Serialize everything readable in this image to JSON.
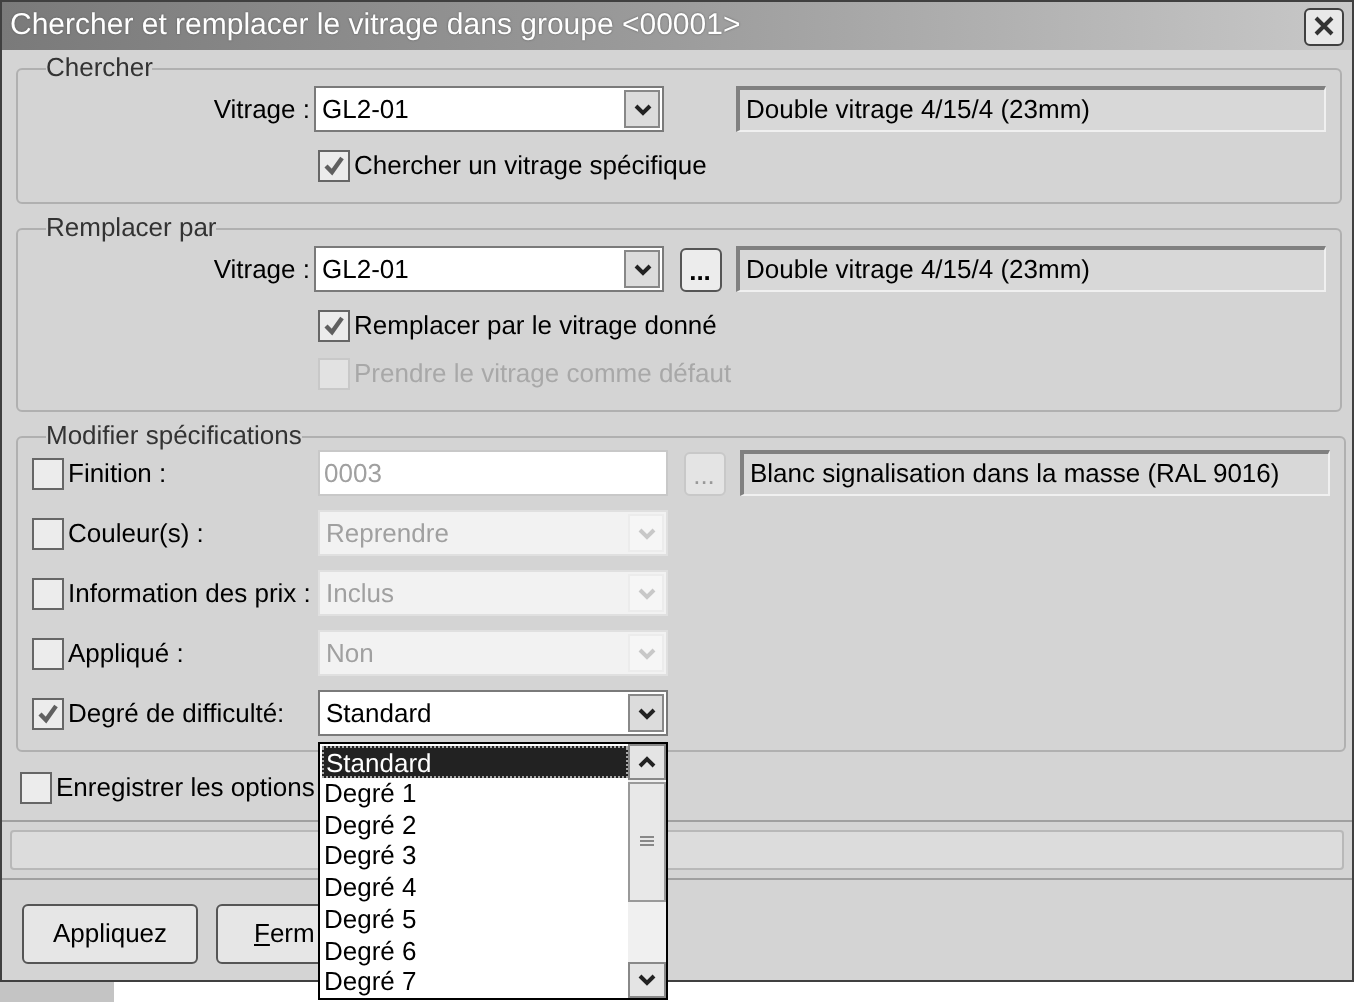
{
  "window": {
    "title": "Chercher et remplacer le vitrage dans groupe <00001>"
  },
  "search": {
    "group_title": "Chercher",
    "label": "Vitrage :",
    "value": "GL2-01",
    "description": "Double vitrage  4/15/4 (23mm)",
    "options": [
      {
        "label": "Chercher un vitrage spécifique",
        "checked": true,
        "disabled": false
      }
    ]
  },
  "replace": {
    "group_title": "Remplacer par",
    "label": "Vitrage :",
    "value": "GL2-01",
    "browse_button": "...",
    "description": "Double vitrage  4/15/4 (23mm)",
    "options": [
      {
        "label": "Remplacer par le vitrage donné",
        "checked": true,
        "disabled": false
      },
      {
        "label": "Prendre le vitrage comme défaut",
        "checked": false,
        "disabled": true
      }
    ]
  },
  "specifications": {
    "group_title": "Modifier spécifications",
    "rows": [
      {
        "kind": "text",
        "label": "Finition :",
        "checked": false,
        "value": "0003",
        "browse_button": "...",
        "description": "Blanc signalisation dans la masse (RAL 9016)"
      },
      {
        "kind": "combo",
        "label": "Couleur(s) :",
        "checked": false,
        "value": "Reprendre"
      },
      {
        "kind": "combo",
        "label": "Information des prix :",
        "checked": false,
        "value": "Inclus"
      },
      {
        "kind": "combo",
        "label": "Appliqué :",
        "checked": false,
        "value": "Non"
      },
      {
        "kind": "combo",
        "label": "Degré de difficulté:",
        "checked": true,
        "value": "Standard",
        "expanded": true
      }
    ]
  },
  "dropdown_list": {
    "items": [
      {
        "label": "Standard",
        "selected": true
      },
      {
        "label": "Degré 1",
        "selected": false
      },
      {
        "label": "Degré 2",
        "selected": false
      },
      {
        "label": "Degré 3",
        "selected": false
      },
      {
        "label": "Degré 4",
        "selected": false
      },
      {
        "label": "Degré 5",
        "selected": false
      },
      {
        "label": "Degré 6",
        "selected": false
      },
      {
        "label": "Degré 7",
        "selected": false
      }
    ]
  },
  "save_options": {
    "label": "Enregistrer les options",
    "checked": false
  },
  "progress": {
    "level": 0
  },
  "buttons": [
    {
      "label": "Appliquez",
      "underline_first": false
    },
    {
      "label": "Ferm",
      "underline_first": true
    }
  ]
}
